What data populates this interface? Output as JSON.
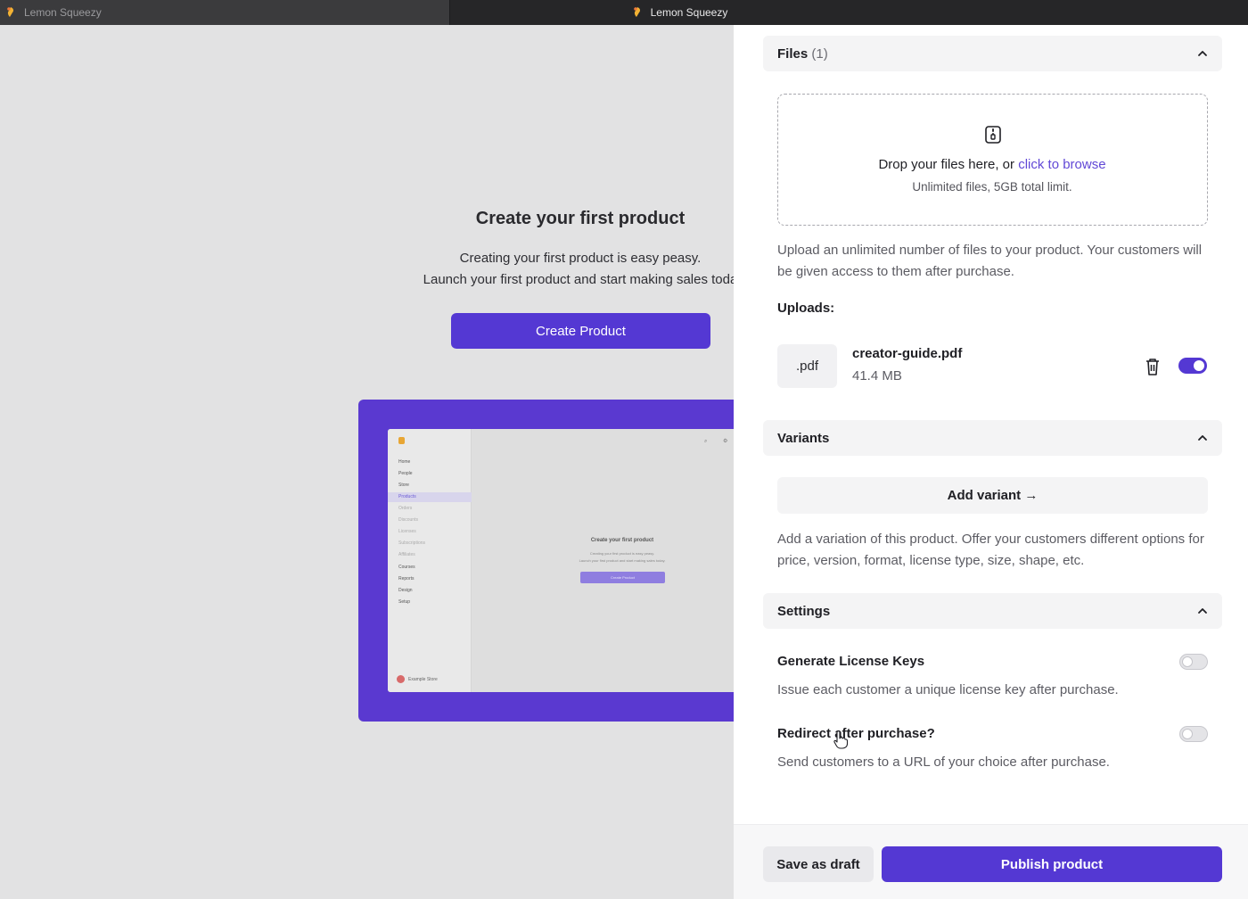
{
  "tabs": [
    {
      "label": "Lemon Squeezy",
      "active": false
    },
    {
      "label": "Lemon Squeezy",
      "active": true
    }
  ],
  "background": {
    "title": "Create your first product",
    "line1": "Creating your first product is easy peasy.",
    "line2": "Launch your first product and start making sales toda",
    "create_button": "Create Product",
    "preview": {
      "nav": [
        "Home",
        "People",
        "Store",
        "Products",
        "Orders",
        "Discounts",
        "Licenses",
        "Subscriptions",
        "Affiliates",
        "Courses",
        "Reports",
        "Design",
        "Setup"
      ],
      "title": "Create your first product",
      "line1": "Creating your first product is easy peasy.",
      "line2": "Launch your first product and start making sales today.",
      "button": "Create Product",
      "store": "Example Store"
    }
  },
  "files": {
    "title": "Files",
    "count": "(1)",
    "dropzone_text": "Drop your files here, or",
    "dropzone_link": "click to browse",
    "dropzone_limit": "Unlimited files, 5GB total limit.",
    "help": "Upload an unlimited number of files to your product. Your customers will be given access to them after purchase.",
    "uploads_label": "Uploads:",
    "uploads": [
      {
        "ext": ".pdf",
        "name": "creator-guide.pdf",
        "size": "41.4 MB",
        "enabled": true
      }
    ]
  },
  "variants": {
    "title": "Variants",
    "add_button": "Add variant →",
    "help": "Add a variation of this product. Offer your customers different options for price, version, format, license type, size, shape, etc."
  },
  "settings": {
    "title": "Settings",
    "items": [
      {
        "title": "Generate License Keys",
        "desc": "Issue each customer a unique license key after purchase.",
        "enabled": false
      },
      {
        "title": "Redirect after purchase?",
        "desc": "Send customers to a URL of your choice after purchase.",
        "enabled": false
      }
    ]
  },
  "footer": {
    "draft_button": "Save as draft",
    "publish_button": "Publish product"
  },
  "colors": {
    "accent": "#5438d3",
    "link": "#6148d6"
  }
}
